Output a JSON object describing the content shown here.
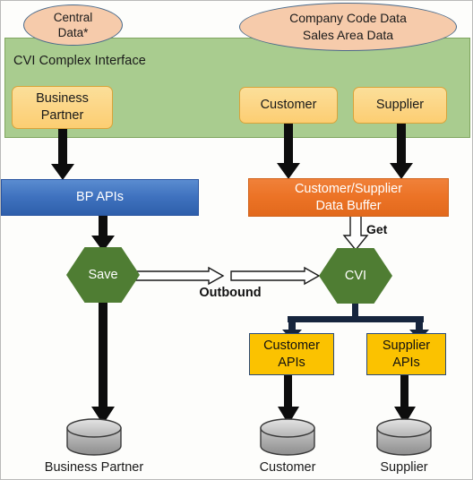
{
  "diagram": {
    "panel": {
      "title": "CVI Complex Interface",
      "color": "#a9cc8f"
    },
    "ellipses": [
      {
        "id": "central-data",
        "lines": [
          "Central",
          "Data*"
        ],
        "color": "#f6cbab"
      },
      {
        "id": "company-code-data",
        "lines": [
          "Company Code Data",
          "Sales Area Data"
        ],
        "color": "#f6cbab"
      }
    ],
    "entities": [
      {
        "id": "business-partner",
        "lines": [
          "Business",
          "Partner"
        ],
        "color": "#fcd584"
      },
      {
        "id": "customer",
        "lines": [
          "Customer"
        ],
        "color": "#fcd584"
      },
      {
        "id": "supplier",
        "lines": [
          "Supplier"
        ],
        "color": "#fcd584"
      }
    ],
    "bars": [
      {
        "id": "bp-apis",
        "lines": [
          "BP APIs"
        ],
        "color": "#3f72bf"
      },
      {
        "id": "customer-supplier-data-buffer",
        "lines": [
          "Customer/Supplier",
          "Data Buffer"
        ],
        "color": "#ec7326"
      }
    ],
    "hexagons": [
      {
        "id": "save",
        "label": "Save",
        "color": "#4f7d33"
      },
      {
        "id": "cvi",
        "label": "CVI",
        "color": "#4f7d33"
      }
    ],
    "api_boxes": [
      {
        "id": "customer-apis",
        "lines": [
          "Customer",
          "APIs"
        ],
        "color": "#fbc200"
      },
      {
        "id": "supplier-apis",
        "lines": [
          "Supplier",
          "APIs"
        ],
        "color": "#fbc200"
      }
    ],
    "flow_labels": {
      "outbound": "Outbound",
      "get": "Get"
    },
    "databases": [
      {
        "id": "db-business-partner",
        "caption": "Business Partner"
      },
      {
        "id": "db-customer",
        "caption": "Customer"
      },
      {
        "id": "db-supplier",
        "caption": "Supplier"
      }
    ]
  }
}
